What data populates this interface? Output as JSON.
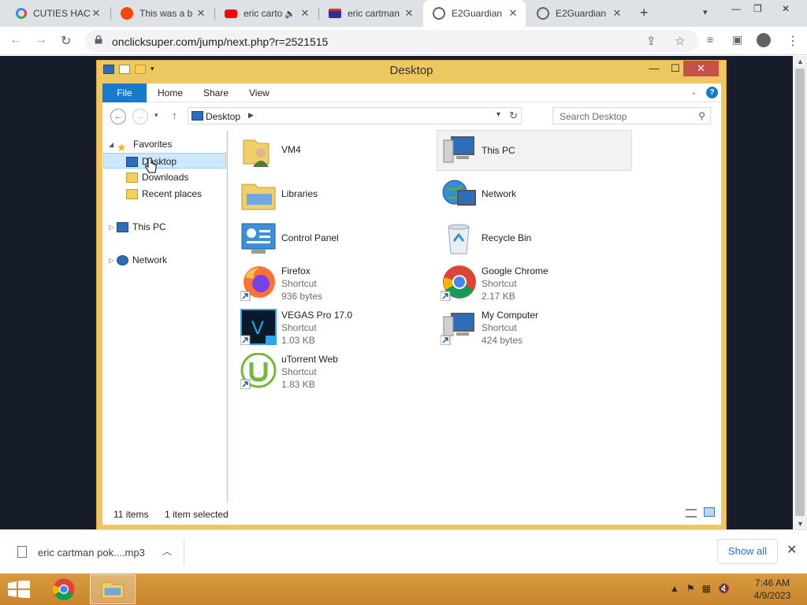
{
  "browser": {
    "tabs": [
      {
        "title": "CUTIES HAC",
        "favicon": "google-icon",
        "active": false
      },
      {
        "title": "This was a b",
        "favicon": "reddit-icon",
        "active": false
      },
      {
        "title": "eric carto",
        "favicon": "youtube-icon",
        "active": false,
        "audio": true
      },
      {
        "title": "eric cartman",
        "favicon": "tv-icon",
        "active": false
      },
      {
        "title": "E2Guardian",
        "favicon": "globe-icon",
        "active": true
      },
      {
        "title": "E2Guardian",
        "favicon": "globe-icon",
        "active": false
      }
    ],
    "url": "onclicksuper.com/jump/next.php?r=2521515"
  },
  "explorer": {
    "title": "Desktop",
    "ribbon_tabs": [
      "File",
      "Home",
      "Share",
      "View"
    ],
    "address": "Desktop",
    "search_placeholder": "Search Desktop",
    "nav": {
      "favorites": "Favorites",
      "favorites_items": [
        "Desktop",
        "Downloads",
        "Recent places"
      ],
      "this_pc": "This PC",
      "network": "Network"
    },
    "items": [
      {
        "name": "VM4",
        "type": "",
        "size": ""
      },
      {
        "name": "This PC",
        "type": "",
        "size": ""
      },
      {
        "name": "Libraries",
        "type": "",
        "size": ""
      },
      {
        "name": "Network",
        "type": "",
        "size": ""
      },
      {
        "name": "Control Panel",
        "type": "",
        "size": ""
      },
      {
        "name": "Recycle Bin",
        "type": "",
        "size": ""
      },
      {
        "name": "Firefox",
        "type": "Shortcut",
        "size": "936 bytes"
      },
      {
        "name": "Google Chrome",
        "type": "Shortcut",
        "size": "2.17 KB"
      },
      {
        "name": "VEGAS Pro 17.0",
        "type": "Shortcut",
        "size": "1.03 KB"
      },
      {
        "name": "My Computer",
        "type": "Shortcut",
        "size": "424 bytes"
      },
      {
        "name": "uTorrent Web",
        "type": "Shortcut",
        "size": "1.83 KB"
      }
    ],
    "status_count": "11 items",
    "status_selected": "1 item selected"
  },
  "downloads": {
    "file": "eric cartman pok....mp3",
    "show_all": "Show all"
  },
  "taskbar": {
    "time": "7:46 AM",
    "date": "4/9/2023"
  },
  "colors": {
    "window_frame": "#ecc762",
    "taskbar": "#d89a3f",
    "accent": "#1979ca"
  }
}
